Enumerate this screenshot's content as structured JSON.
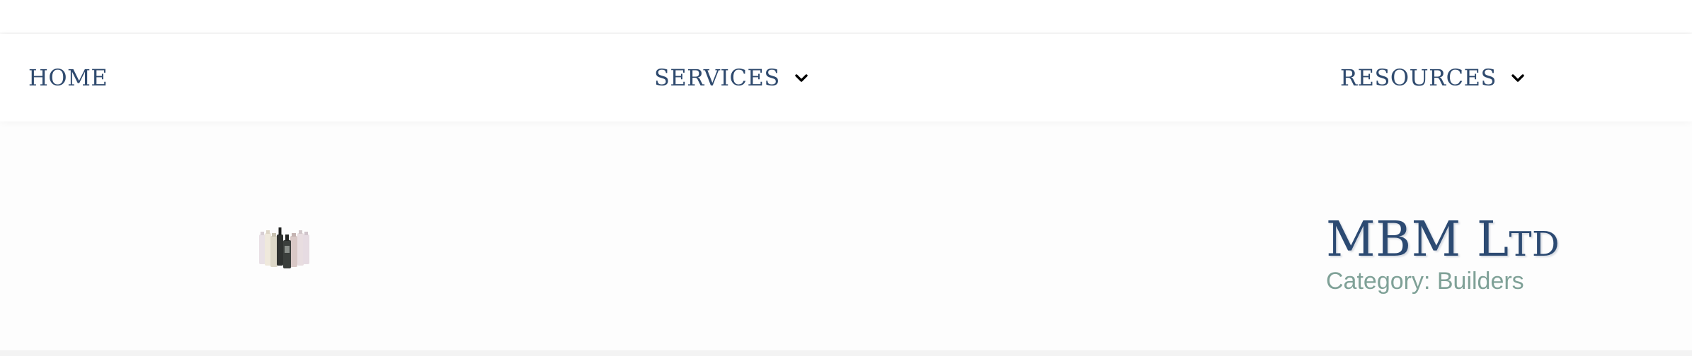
{
  "nav": {
    "items": [
      {
        "label": "HOME",
        "has_dropdown": false
      },
      {
        "label": "SERVICES",
        "has_dropdown": true
      },
      {
        "label": "RESOURCES",
        "has_dropdown": true
      }
    ]
  },
  "listing": {
    "name": "MBM Ltd",
    "category": "Category: Builders",
    "thumbnail_icon": "product-bottles-image"
  },
  "colors": {
    "nav_text": "#2f4a6e",
    "title_text": "#2c4a72",
    "category_text": "#7fa197",
    "background": "#fdfdfd"
  }
}
